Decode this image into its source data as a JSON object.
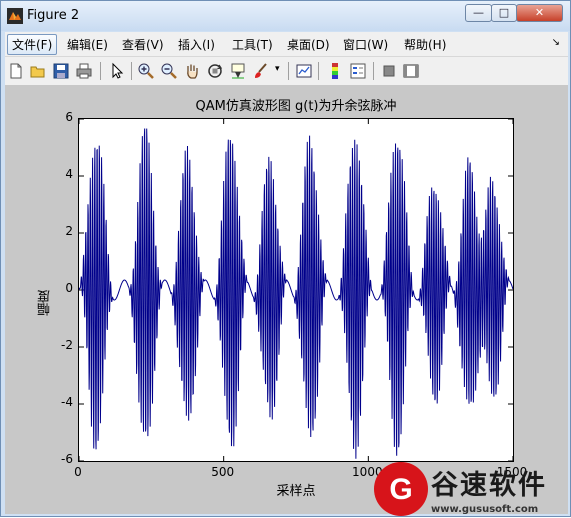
{
  "window": {
    "title": "Figure 2",
    "minimize_label": "—",
    "maximize_label": "□",
    "close_label": "✕"
  },
  "menu": {
    "items": [
      "文件(F)",
      "编辑(E)",
      "查看(V)",
      "插入(I)",
      "工具(T)",
      "桌面(D)",
      "窗口(W)",
      "帮助(H)"
    ],
    "overflow_arrow": "↘"
  },
  "toolbar": {
    "icons": [
      "new-figure-icon",
      "open-file-icon",
      "save-icon",
      "print-icon",
      "edit-plot-arrow-icon",
      "zoom-in-icon",
      "zoom-out-icon",
      "pan-hand-icon",
      "rotate-3d-icon",
      "data-cursor-icon",
      "brush-icon",
      "link-plot-icon",
      "colorbar-icon",
      "legend-icon",
      "hide-plot-tools-icon",
      "show-plot-tools-icon"
    ]
  },
  "chart_data": {
    "type": "line",
    "title": "QAM仿真波形图  g(t)为升余弦脉冲",
    "xlabel": "采样点",
    "ylabel": "幅度",
    "xlim": [
      0,
      1500
    ],
    "ylim": [
      -6,
      6
    ],
    "xticks": [
      0,
      500,
      1000,
      1500
    ],
    "yticks": [
      6,
      4,
      2,
      0,
      -2,
      -4,
      -6
    ],
    "grid": false,
    "series_color": "#00008b",
    "series": [
      {
        "carrier_cycles_per_sample": 0.128,
        "burst_centers": [
          60,
          230,
          375,
          525,
          660,
          800,
          955,
          1100,
          1230,
          1350,
          1430
        ],
        "envelope_peaks": [
          5.6,
          5.7,
          4.8,
          5.6,
          4.6,
          5.3,
          5.6,
          5.7,
          3.9,
          4.5,
          3.9
        ]
      }
    ]
  },
  "watermark": {
    "logo_letter": "G",
    "brand": "谷速软件",
    "url": "www.gususoft.com"
  }
}
